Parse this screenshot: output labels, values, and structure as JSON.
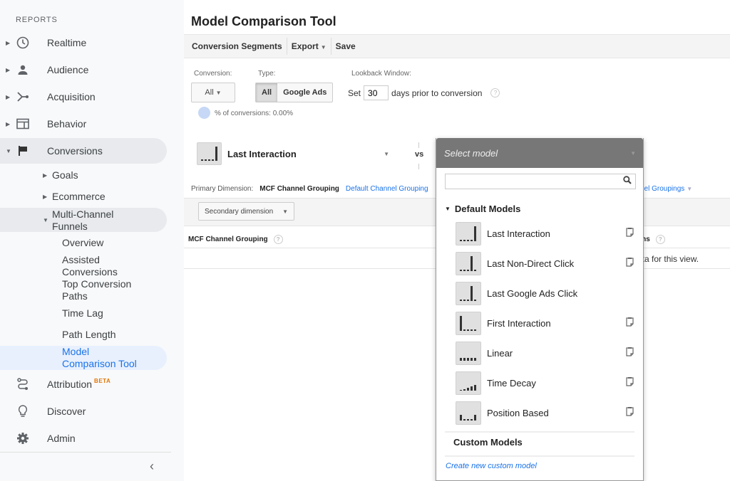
{
  "sidebar": {
    "heading": "REPORTS",
    "items": [
      {
        "label": "Realtime",
        "icon": "clock-icon"
      },
      {
        "label": "Audience",
        "icon": "person-icon"
      },
      {
        "label": "Acquisition",
        "icon": "acquisition-icon"
      },
      {
        "label": "Behavior",
        "icon": "behavior-icon"
      },
      {
        "label": "Conversions",
        "icon": "flag-icon"
      }
    ],
    "conversions_children": [
      {
        "label": "Goals"
      },
      {
        "label": "Ecommerce"
      }
    ],
    "mcf": {
      "label": "Multi-Channel Funnels",
      "children": [
        "Overview",
        "Assisted Conversions",
        "Top Conversion Paths",
        "Time Lag",
        "Path Length",
        "Model Comparison Tool"
      ],
      "active": "Model Comparison Tool"
    },
    "bottom_items": [
      {
        "label": "Attribution",
        "badge": "BETA",
        "icon": "attribution-icon"
      },
      {
        "label": "Discover",
        "icon": "lightbulb-icon"
      },
      {
        "label": "Admin",
        "icon": "gear-icon"
      }
    ],
    "collapse_icon": "chevron-left-icon"
  },
  "main": {
    "title": "Model Comparison Tool",
    "toolbar": {
      "conversion_segments": "Conversion Segments",
      "export": "Export",
      "save": "Save"
    },
    "filters": {
      "conversion_label": "Conversion:",
      "conversion_value": "All",
      "type_label": "Type:",
      "type_options": [
        "All",
        "Google Ads"
      ],
      "type_selected": "All",
      "lookback_label": "Lookback Window:",
      "lookback_prefix": "Set",
      "lookback_value": "30",
      "lookback_suffix": "days prior to conversion",
      "pct_conversions": "% of conversions: 0.00%"
    },
    "model_a": "Last Interaction",
    "vs": "vs",
    "primary_dimension": {
      "label": "Primary Dimension:",
      "current": "MCF Channel Grouping",
      "alt": "Default Channel Grouping",
      "other_partial": "nel Groupings"
    },
    "secondary_dimension": "Secondary dimension",
    "table": {
      "col1": "MCF Channel Grouping",
      "col2_partial": "ons",
      "empty_msg_partial": "ata for this view."
    }
  },
  "model_dropdown": {
    "placeholder": "Select model",
    "search_value": "",
    "default_group": "Default Models",
    "models": [
      {
        "name": "Last Interaction",
        "copyable": true,
        "icon": "last-interaction-icon"
      },
      {
        "name": "Last Non-Direct Click",
        "copyable": true,
        "icon": "last-non-direct-click-icon"
      },
      {
        "name": "Last Google Ads Click",
        "copyable": false,
        "icon": "last-google-ads-click-icon"
      },
      {
        "name": "First Interaction",
        "copyable": true,
        "icon": "first-interaction-icon"
      },
      {
        "name": "Linear",
        "copyable": true,
        "icon": "linear-icon"
      },
      {
        "name": "Time Decay",
        "copyable": true,
        "icon": "time-decay-icon"
      },
      {
        "name": "Position Based",
        "copyable": true,
        "icon": "position-based-icon"
      }
    ],
    "custom_group": "Custom Models",
    "create_link": "Create new custom model"
  },
  "colors": {
    "accent": "#1a73e8",
    "beta": "#e37400",
    "dropdown_header": "#777777"
  }
}
